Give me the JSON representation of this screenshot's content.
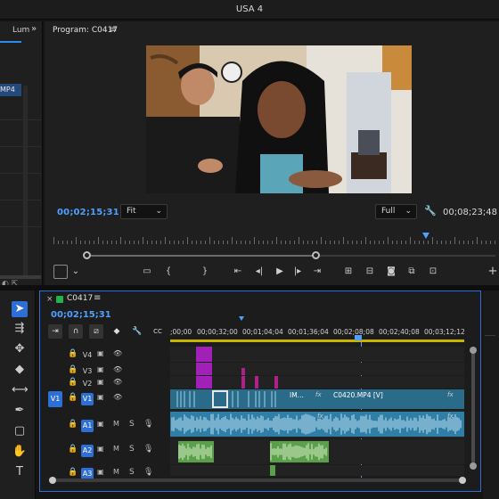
{
  "window": {
    "title": "USA 4"
  },
  "source_panel": {
    "tab_label": "Lum",
    "more_icon": "double-chevron-right-icon",
    "clip_label": "MP4"
  },
  "program_monitor": {
    "tab_label": "Program: C0417",
    "menu_icon": "hamburger-menu-icon",
    "timecode_current": "00;02;15;31",
    "fit_option": "Fit",
    "resolution_option": "Full",
    "timecode_duration": "00;08;23;48",
    "transport": {
      "settings": "settings-icon",
      "buttons": [
        "safe-margins-icon",
        "mark-in-icon",
        "mark-out-icon",
        "go-to-in-icon",
        "step-back-icon",
        "play-icon",
        "step-forward-icon",
        "go-to-out-icon",
        "insert-icon",
        "overwrite-icon",
        "export-frame-icon",
        "comparison-view-icon",
        "add-button-icon"
      ]
    }
  },
  "tools": [
    "selection-tool-icon",
    "track-select-icon",
    "ripple-edit-icon",
    "razor-icon",
    "slip-icon",
    "pen-icon",
    "rectangle-icon",
    "hand-icon",
    "type-icon"
  ],
  "timeline": {
    "tab_label": "C0417",
    "menu_icon": "hamburger-menu-icon",
    "timecode": "00;02;15;31",
    "tool_icons": [
      "insert-nest-icon",
      "snap-icon",
      "linked-selection-icon",
      "add-marker-icon",
      "wrench-icon",
      "captions-icon"
    ],
    "time_ruler": [
      ";00;00",
      "00;00;32;00",
      "00;01;04;04",
      "00;01;36;04",
      "00;02;08;08",
      "00;02;40;08",
      "00;03;12;12"
    ],
    "tracks": [
      {
        "name": "V4",
        "type": "video"
      },
      {
        "name": "V3",
        "type": "video"
      },
      {
        "name": "V2",
        "type": "video"
      },
      {
        "name": "V1",
        "type": "video",
        "source": "V1"
      },
      {
        "name": "A1",
        "type": "audio"
      },
      {
        "name": "A2",
        "type": "audio"
      },
      {
        "name": "A3",
        "type": "audio"
      }
    ],
    "clips": {
      "v1_clip_a": "IM...",
      "v1_clip_b": "C0420.MP4 [V]",
      "fx": "fx",
      "mute": "M",
      "solo": "S"
    }
  }
}
